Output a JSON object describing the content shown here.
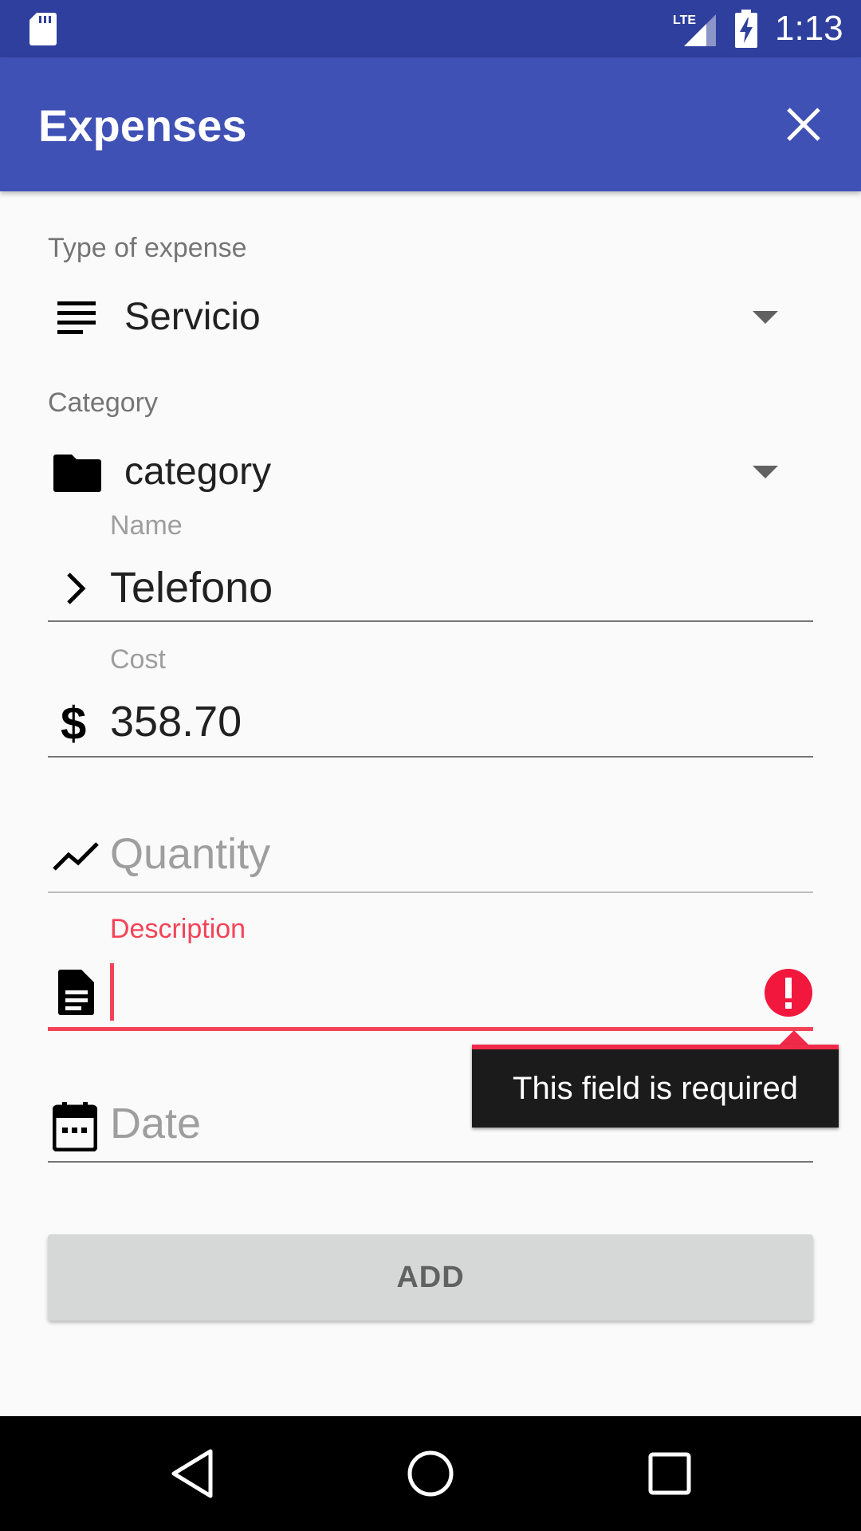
{
  "status_bar": {
    "time": "1:13",
    "network_label": "LTE",
    "icons": [
      "sd-card-icon",
      "lte-signal-icon",
      "battery-charging-icon"
    ]
  },
  "app_bar": {
    "title": "Expenses",
    "close_icon": "close-icon"
  },
  "form": {
    "type_of_expense": {
      "label": "Type of expense",
      "value": "Servicio",
      "icon": "list-lines-icon"
    },
    "category": {
      "label": "Category",
      "value": "category",
      "icon": "folder-icon"
    },
    "name": {
      "label": "Name",
      "value": "Telefono",
      "icon": "chevron-right-icon"
    },
    "cost": {
      "label": "Cost",
      "value": "358.70",
      "icon": "dollar-icon"
    },
    "quantity": {
      "placeholder": "Quantity",
      "icon": "trending-up-icon"
    },
    "description": {
      "label": "Description",
      "value": "",
      "icon": "document-icon",
      "error_message": "This field is required",
      "error_color": "#f44357"
    },
    "date": {
      "placeholder": "Date",
      "icon": "calendar-icon"
    },
    "add_button_label": "ADD"
  },
  "colors": {
    "status_bar": "#2f3f9e",
    "app_bar": "#3f51b5",
    "error": "#f44357",
    "button_bg": "#d6d7d7"
  },
  "nav_bar": {
    "icons": [
      "back-icon",
      "home-icon",
      "recents-icon"
    ]
  }
}
